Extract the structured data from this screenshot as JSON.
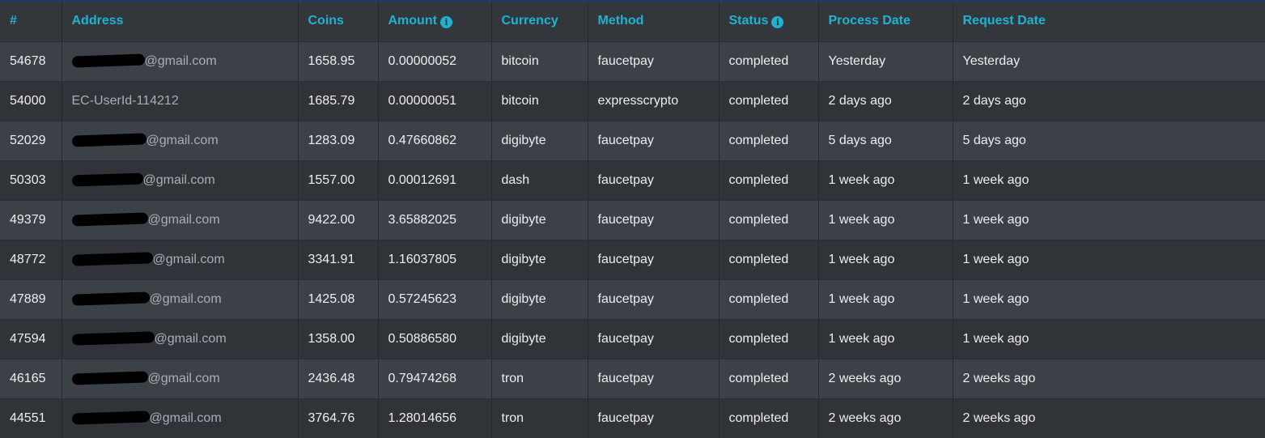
{
  "headers": {
    "id": "#",
    "address": "Address",
    "coins": "Coins",
    "amount": "Amount",
    "currency": "Currency",
    "method": "Method",
    "status": "Status",
    "process_date": "Process Date",
    "request_date": "Request Date"
  },
  "icons": {
    "amount_info": "info-icon",
    "status_info": "info-icon"
  },
  "colors": {
    "header_text": "#1fb3d1",
    "row_odd": "#3c4047",
    "row_even": "#303338",
    "address_text": "#a9afb6"
  },
  "rows": [
    {
      "id": "54678",
      "address": "@gmail.com",
      "address_redacted": true,
      "coins": "1658.95",
      "amount": "0.00000052",
      "currency": "bitcoin",
      "method": "faucetpay",
      "status": "completed",
      "process_date": "Yesterday",
      "request_date": "Yesterday"
    },
    {
      "id": "54000",
      "address": "EC-UserId-114212",
      "address_redacted": false,
      "coins": "1685.79",
      "amount": "0.00000051",
      "currency": "bitcoin",
      "method": "expresscrypto",
      "status": "completed",
      "process_date": "2 days ago",
      "request_date": "2 days ago"
    },
    {
      "id": "52029",
      "address": "@gmail.com",
      "address_redacted": true,
      "coins": "1283.09",
      "amount": "0.47660862",
      "currency": "digibyte",
      "method": "faucetpay",
      "status": "completed",
      "process_date": "5 days ago",
      "request_date": "5 days ago"
    },
    {
      "id": "50303",
      "address": "@gmail.com",
      "address_redacted": true,
      "coins": "1557.00",
      "amount": "0.00012691",
      "currency": "dash",
      "method": "faucetpay",
      "status": "completed",
      "process_date": "1 week ago",
      "request_date": "1 week ago"
    },
    {
      "id": "49379",
      "address": "@gmail.com",
      "address_redacted": true,
      "coins": "9422.00",
      "amount": "3.65882025",
      "currency": "digibyte",
      "method": "faucetpay",
      "status": "completed",
      "process_date": "1 week ago",
      "request_date": "1 week ago"
    },
    {
      "id": "48772",
      "address": "@gmail.com",
      "address_redacted": true,
      "coins": "3341.91",
      "amount": "1.16037805",
      "currency": "digibyte",
      "method": "faucetpay",
      "status": "completed",
      "process_date": "1 week ago",
      "request_date": "1 week ago"
    },
    {
      "id": "47889",
      "address": "@gmail.com",
      "address_redacted": true,
      "coins": "1425.08",
      "amount": "0.57245623",
      "currency": "digibyte",
      "method": "faucetpay",
      "status": "completed",
      "process_date": "1 week ago",
      "request_date": "1 week ago"
    },
    {
      "id": "47594",
      "address": "@gmail.com",
      "address_redacted": true,
      "coins": "1358.00",
      "amount": "0.50886580",
      "currency": "digibyte",
      "method": "faucetpay",
      "status": "completed",
      "process_date": "1 week ago",
      "request_date": "1 week ago"
    },
    {
      "id": "46165",
      "address": "@gmail.com",
      "address_redacted": true,
      "coins": "2436.48",
      "amount": "0.79474268",
      "currency": "tron",
      "method": "faucetpay",
      "status": "completed",
      "process_date": "2 weeks ago",
      "request_date": "2 weeks ago"
    },
    {
      "id": "44551",
      "address": "@gmail.com",
      "address_redacted": true,
      "coins": "3764.76",
      "amount": "1.28014656",
      "currency": "tron",
      "method": "faucetpay",
      "status": "completed",
      "process_date": "2 weeks ago",
      "request_date": "2 weeks ago"
    }
  ]
}
